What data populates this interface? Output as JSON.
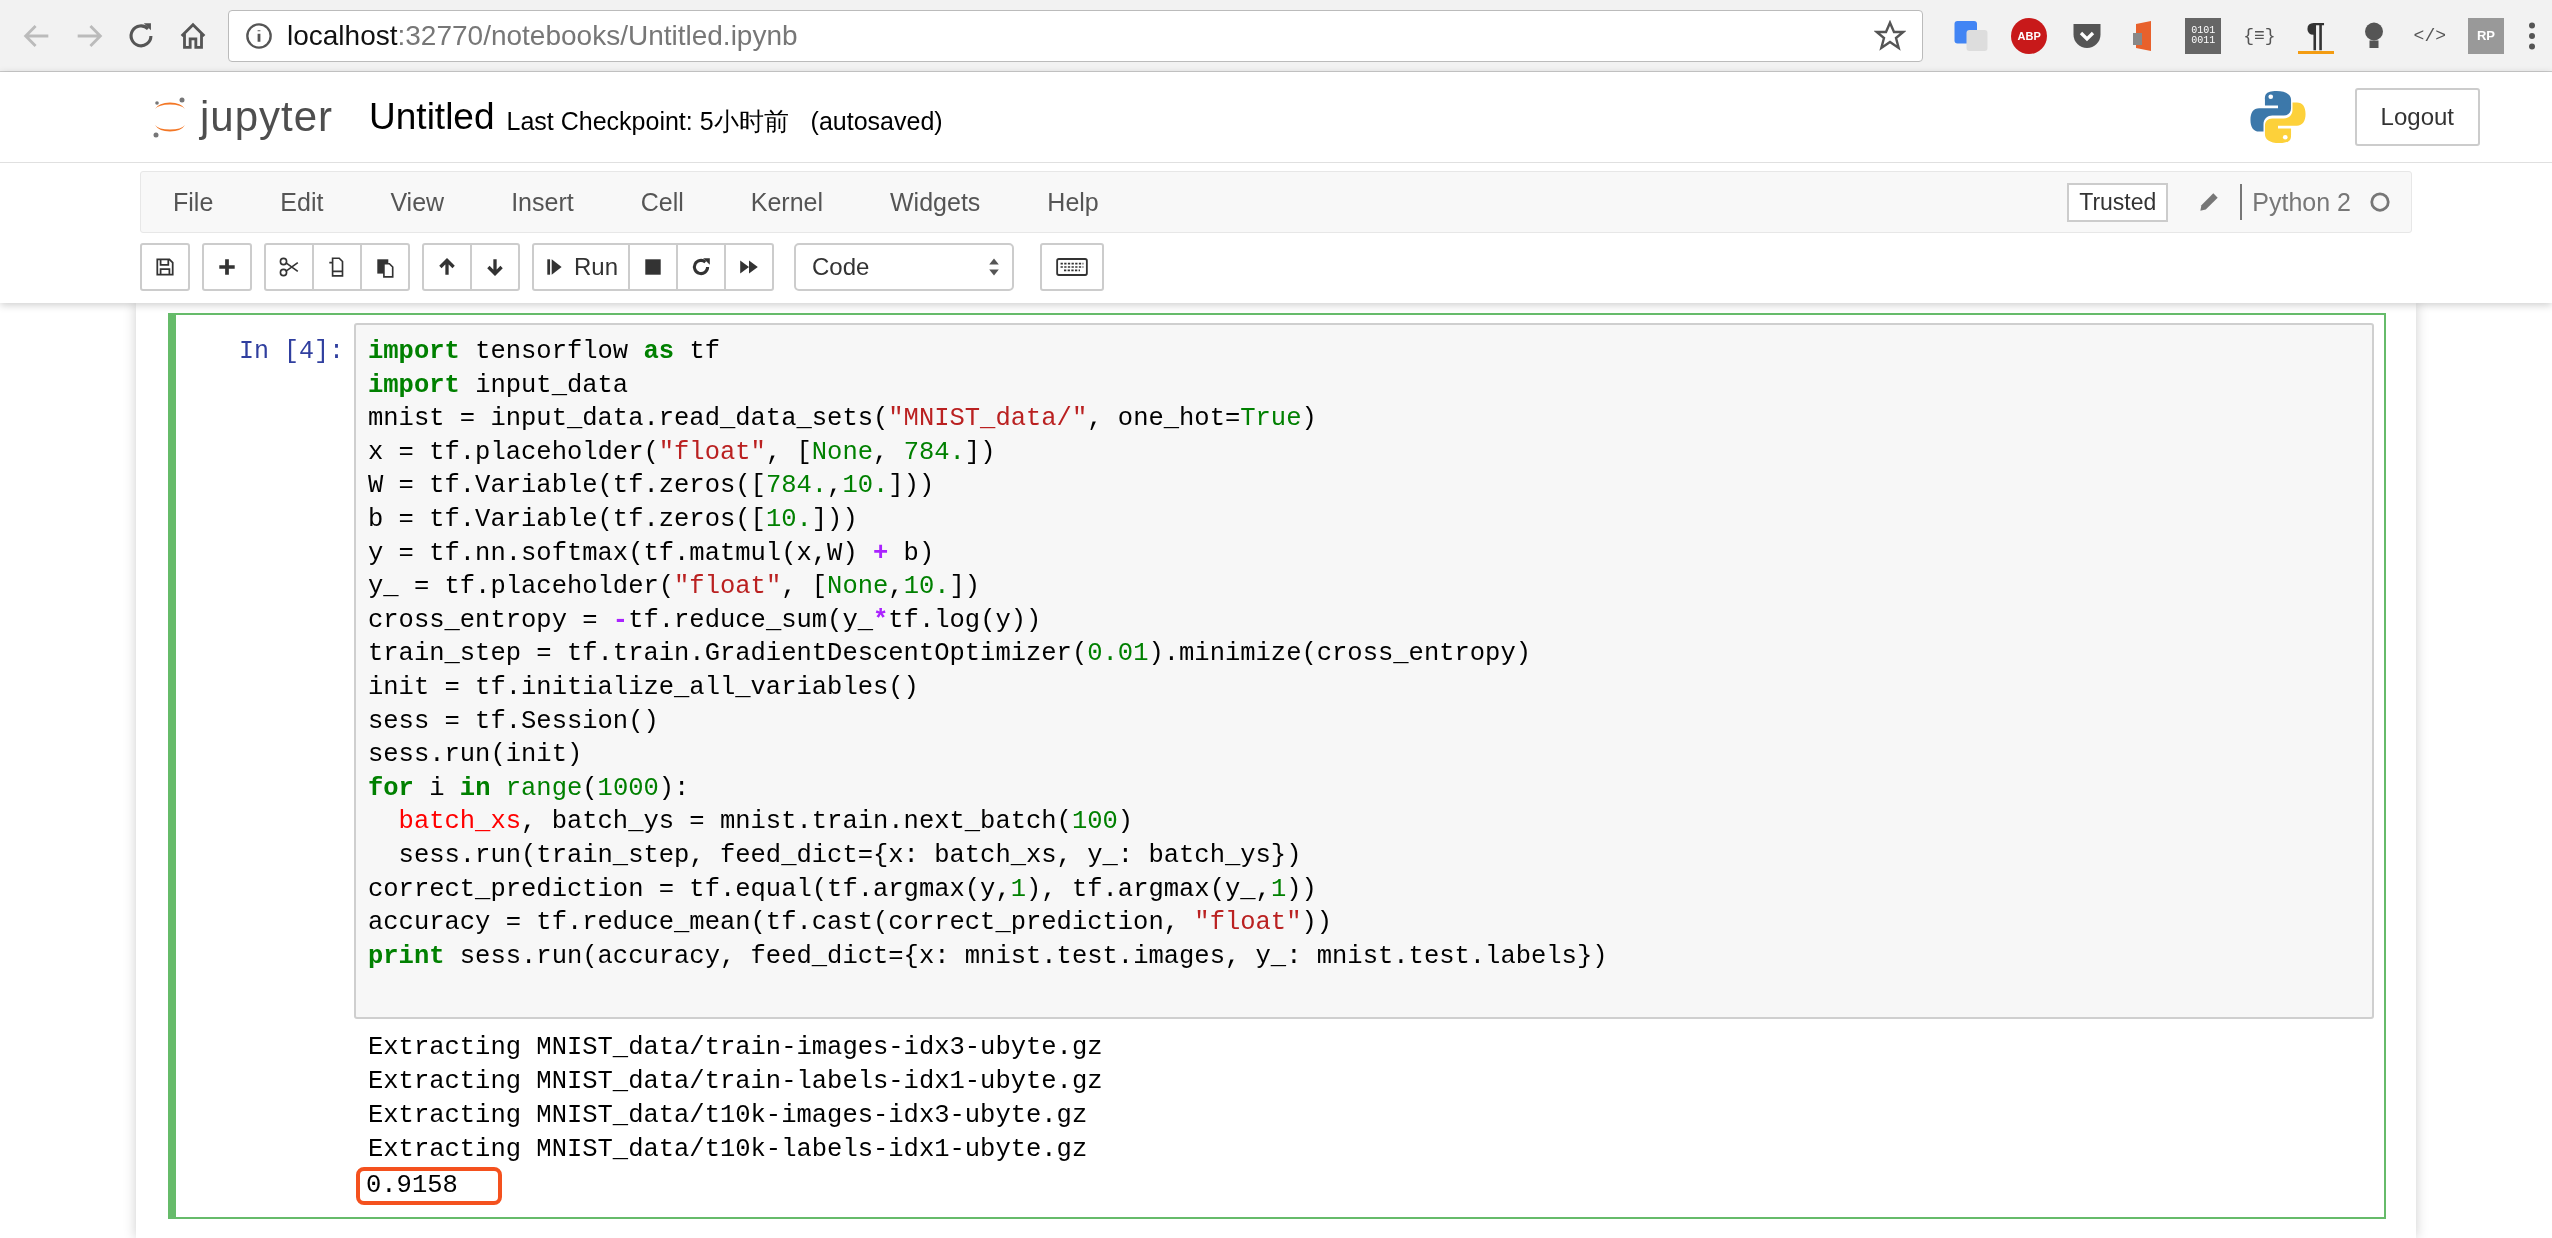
{
  "browser": {
    "url_host": "localhost",
    "url_rest": ":32770/notebooks/Untitled.ipynb",
    "extensions": [
      {
        "kind": "translate"
      },
      {
        "kind": "abp",
        "label": "ABP"
      },
      {
        "kind": "pocket"
      },
      {
        "kind": "office"
      },
      {
        "kind": "binary",
        "label": "0101 0011"
      },
      {
        "kind": "braces",
        "label": "{≡}"
      },
      {
        "kind": "pilcrow",
        "label": "¶"
      },
      {
        "kind": "bulb"
      },
      {
        "kind": "code",
        "label": "</>"
      },
      {
        "kind": "rp",
        "label": "RP"
      }
    ]
  },
  "header": {
    "logo_text": "jupyter",
    "notebook_name": "Untitled",
    "checkpoint": "Last Checkpoint: 5小时前",
    "autosave": "(autosaved)",
    "logout": "Logout"
  },
  "menubar": {
    "items": [
      "File",
      "Edit",
      "View",
      "Insert",
      "Cell",
      "Kernel",
      "Widgets",
      "Help"
    ],
    "trusted": "Trusted",
    "kernel_name": "Python 2",
    "kernel_busy": false
  },
  "toolbar": {
    "groups": [
      [
        {
          "kind": "save"
        }
      ],
      [
        {
          "kind": "add"
        }
      ],
      [
        {
          "kind": "cut"
        },
        {
          "kind": "copy"
        },
        {
          "kind": "paste"
        }
      ],
      [
        {
          "kind": "up"
        },
        {
          "kind": "down"
        }
      ],
      [
        {
          "kind": "run",
          "label": "Run"
        },
        {
          "kind": "stop"
        },
        {
          "kind": "restart"
        },
        {
          "kind": "fast-forward"
        }
      ]
    ],
    "cell_type": "Code"
  },
  "cell": {
    "selected": true,
    "prompt": "In [4]:",
    "code": [
      [
        {
          "kind": "keyword",
          "s": "import"
        },
        {
          "s": " tensorflow "
        },
        {
          "kind": "keyword",
          "s": "as"
        },
        {
          "s": " tf"
        }
      ],
      [
        {
          "kind": "keyword",
          "s": "import"
        },
        {
          "s": " input_data"
        }
      ],
      [
        {
          "s": "mnist = input_data.read_data_sets("
        },
        {
          "kind": "string",
          "s": "\"MNIST_data/\""
        },
        {
          "s": ", one_hot="
        },
        {
          "kind": "builtin",
          "s": "True"
        },
        {
          "s": ")"
        }
      ],
      [
        {
          "s": "x = tf.placeholder("
        },
        {
          "kind": "string",
          "s": "\"float\""
        },
        {
          "s": ", ["
        },
        {
          "kind": "builtin",
          "s": "None"
        },
        {
          "s": ", "
        },
        {
          "kind": "number",
          "s": "784."
        },
        {
          "s": "])"
        }
      ],
      [
        {
          "s": "W = tf.Variable(tf.zeros(["
        },
        {
          "kind": "number",
          "s": "784."
        },
        {
          "s": ","
        },
        {
          "kind": "number",
          "s": "10."
        },
        {
          "s": "]))"
        }
      ],
      [
        {
          "s": "b = tf.Variable(tf.zeros(["
        },
        {
          "kind": "number",
          "s": "10."
        },
        {
          "s": "]))"
        }
      ],
      [
        {
          "s": "y = tf.nn.softmax(tf.matmul(x,W) "
        },
        {
          "kind": "operator",
          "s": "+"
        },
        {
          "s": " b)"
        }
      ],
      [
        {
          "s": "y_ = tf.placeholder("
        },
        {
          "kind": "string",
          "s": "\"float\""
        },
        {
          "s": ", ["
        },
        {
          "kind": "builtin",
          "s": "None"
        },
        {
          "s": ","
        },
        {
          "kind": "number",
          "s": "10."
        },
        {
          "s": "])"
        }
      ],
      [
        {
          "s": "cross_entropy = "
        },
        {
          "kind": "operator",
          "s": "-"
        },
        {
          "s": "tf.reduce_sum(y_"
        },
        {
          "kind": "operator",
          "s": "*"
        },
        {
          "s": "tf.log(y))"
        }
      ],
      [
        {
          "s": "train_step = tf.train.GradientDescentOptimizer("
        },
        {
          "kind": "number",
          "s": "0.01"
        },
        {
          "s": ").minimize(cross_entropy)"
        }
      ],
      [
        {
          "s": "init = tf.initialize_all_variables()"
        }
      ],
      [
        {
          "s": "sess = tf.Session()"
        }
      ],
      [
        {
          "s": "sess.run(init)"
        }
      ],
      [
        {
          "kind": "keyword",
          "s": "for"
        },
        {
          "s": " i "
        },
        {
          "kind": "keyword",
          "s": "in"
        },
        {
          "kind": "builtin",
          "s": " range"
        },
        {
          "s": "("
        },
        {
          "kind": "number",
          "s": "1000"
        },
        {
          "s": "):"
        }
      ],
      [
        {
          "kind": "error",
          "s": "  batch_xs"
        },
        {
          "s": ", batch_ys = mnist.train.next_batch("
        },
        {
          "kind": "number",
          "s": "100"
        },
        {
          "s": ")"
        }
      ],
      [
        {
          "s": "  sess.run(train_step, feed_dict={x: batch_xs, y_: batch_ys})"
        }
      ],
      [
        {
          "s": "correct_prediction = tf.equal(tf.argmax(y,"
        },
        {
          "kind": "number",
          "s": "1"
        },
        {
          "s": "), tf.argmax(y_,"
        },
        {
          "kind": "number",
          "s": "1"
        },
        {
          "s": "))"
        }
      ],
      [
        {
          "s": "accuracy = tf.reduce_mean(tf.cast(correct_prediction, "
        },
        {
          "kind": "string",
          "s": "\"float\""
        },
        {
          "s": "))"
        }
      ],
      [
        {
          "kind": "keyword",
          "s": "print"
        },
        {
          "s": " sess.run(accuracy, feed_dict={x: mnist.test.images, y_: mnist.test.labels})"
        }
      ]
    ],
    "output": [
      {
        "text": "Extracting MNIST_data/train-images-idx3-ubyte.gz",
        "boxed": false
      },
      {
        "text": "Extracting MNIST_data/train-labels-idx1-ubyte.gz",
        "boxed": false
      },
      {
        "text": "Extracting MNIST_data/t10k-images-idx3-ubyte.gz",
        "boxed": false
      },
      {
        "text": "Extracting MNIST_data/t10k-labels-idx1-ubyte.gz",
        "boxed": false
      },
      {
        "text": "0.9158",
        "boxed": true
      }
    ]
  }
}
